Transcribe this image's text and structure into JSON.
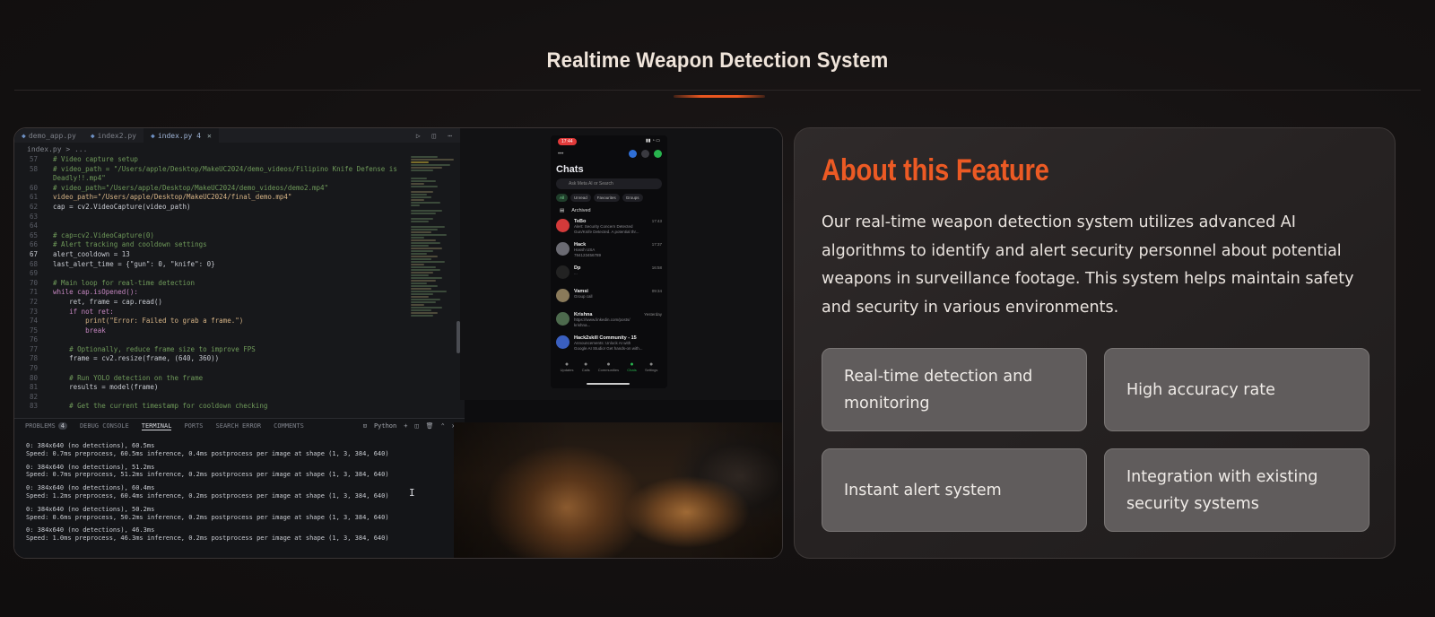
{
  "page": {
    "title": "Realtime Weapon Detection System"
  },
  "editor": {
    "tabs": [
      {
        "label": "demo_app.py",
        "active": false
      },
      {
        "label": "index2.py",
        "active": false
      },
      {
        "label": "index.py 4",
        "active": true
      }
    ],
    "breadcrumb": "index.py > ...",
    "code_lines": [
      {
        "n": "57",
        "text": "  # Video capture setup",
        "cls": "cmt"
      },
      {
        "n": "58",
        "text": "  # video_path = \"/Users/apple/Desktop/MakeUC2024/demo_videos/Filipino Knife Defense is",
        "cls": "cmt"
      },
      {
        "n": "",
        "text": "  Deadly!!.mp4\"",
        "cls": "cmt"
      },
      {
        "n": "60",
        "text": "  # video_path=\"/Users/apple/Desktop/MakeUC2024/demo_videos/demo2.mp4\"",
        "cls": "cmt"
      },
      {
        "n": "61",
        "text": "  video_path=\"/Users/apple/Desktop/MakeUC2024/final_demo.mp4\"",
        "cls": "str"
      },
      {
        "n": "62",
        "text": "  cap = cv2.VideoCapture(video_path)",
        "cls": ""
      },
      {
        "n": "63",
        "text": "",
        "cls": ""
      },
      {
        "n": "64",
        "text": "",
        "cls": ""
      },
      {
        "n": "65",
        "text": "  # cap=cv2.VideoCapture(0)",
        "cls": "cmt"
      },
      {
        "n": "66",
        "text": "  # Alert tracking and cooldown settings",
        "cls": "cmt"
      },
      {
        "n": "67",
        "text": "  alert_cooldown = 13",
        "cls": "",
        "cur": true
      },
      {
        "n": "68",
        "text": "  last_alert_time = {\"gun\": 0, \"knife\": 0}",
        "cls": ""
      },
      {
        "n": "69",
        "text": "",
        "cls": ""
      },
      {
        "n": "70",
        "text": "  # Main loop for real-time detection",
        "cls": "cmt"
      },
      {
        "n": "71",
        "text": "  while cap.isOpened():",
        "cls": "kw"
      },
      {
        "n": "72",
        "text": "      ret, frame = cap.read()",
        "cls": ""
      },
      {
        "n": "73",
        "text": "      if not ret:",
        "cls": "kw"
      },
      {
        "n": "74",
        "text": "          print(\"Error: Failed to grab a frame.\")",
        "cls": "str"
      },
      {
        "n": "75",
        "text": "          break",
        "cls": "kw"
      },
      {
        "n": "76",
        "text": "",
        "cls": ""
      },
      {
        "n": "77",
        "text": "      # Optionally, reduce frame size to improve FPS",
        "cls": "cmt"
      },
      {
        "n": "78",
        "text": "      frame = cv2.resize(frame, (640, 360))",
        "cls": ""
      },
      {
        "n": "79",
        "text": "",
        "cls": ""
      },
      {
        "n": "80",
        "text": "      # Run YOLO detection on the frame",
        "cls": "cmt"
      },
      {
        "n": "81",
        "text": "      results = model(frame)",
        "cls": ""
      },
      {
        "n": "82",
        "text": "",
        "cls": ""
      },
      {
        "n": "83",
        "text": "      # Get the current timestamp for cooldown checking",
        "cls": "cmt"
      }
    ],
    "panel_tabs": [
      {
        "label": "PROBLEMS",
        "badge": "4",
        "active": false
      },
      {
        "label": "DEBUG CONSOLE",
        "active": false
      },
      {
        "label": "TERMINAL",
        "active": true
      },
      {
        "label": "PORTS",
        "active": false
      },
      {
        "label": "SEARCH ERROR",
        "active": false
      },
      {
        "label": "COMMENTS",
        "active": false
      }
    ],
    "panel_tools_label": "Python",
    "terminal": [
      {
        "a": "0: 384x640 (no detections), 60.5ms",
        "b": "Speed: 0.7ms preprocess, 60.5ms inference, 0.4ms postprocess per image at shape (1, 3, 384, 640)"
      },
      {
        "a": "0: 384x640 (no detections), 51.2ms",
        "b": "Speed: 0.7ms preprocess, 51.2ms inference, 0.2ms postprocess per image at shape (1, 3, 384, 640)"
      },
      {
        "a": "0: 384x640 (no detections), 60.4ms",
        "b": "Speed: 1.2ms preprocess, 60.4ms inference, 0.2ms postprocess per image at shape (1, 3, 384, 640)"
      },
      {
        "a": "0: 384x640 (no detections), 50.2ms",
        "b": "Speed: 0.6ms preprocess, 50.2ms inference, 0.2ms postprocess per image at shape (1, 3, 384, 640)"
      },
      {
        "a": "0: 384x640 (no detections), 46.3ms",
        "b": "Speed: 1.0ms preprocess, 46.3ms inference, 0.2ms postprocess per image at shape (1, 3, 384, 640)"
      }
    ]
  },
  "phone": {
    "time": "17:44",
    "title": "Chats",
    "search_placeholder": "Ask Meta AI or Search",
    "filters": [
      "All",
      "Unread",
      "Favourites",
      "Groups"
    ],
    "archived": "Archived",
    "chats": [
      {
        "name": "TeBo",
        "preview": "Alert: Security Concern Detected",
        "preview2": "Gun/Knife Detected. A potential thr...",
        "time": "17:43",
        "color": "#d33a3a"
      },
      {
        "name": "Hack",
        "preview": "Hassh USA",
        "preview2": "784123456789",
        "time": "17:37",
        "color": "#6b6b73"
      },
      {
        "name": "Dp",
        "preview": "...",
        "preview2": "",
        "time": "16:58",
        "color": "#222"
      },
      {
        "name": "Vamsi",
        "preview": "Group call",
        "preview2": "",
        "time": "09:34",
        "color": "#8a7a5a"
      },
      {
        "name": "Krishna",
        "preview": "https://www.linkedin.com/posts/",
        "preview2": "krishna...",
        "time": "Yesterday",
        "color": "#4d6a4d"
      },
      {
        "name": "Hack2skill Community - 15",
        "preview": "Announcements: Unlock AI with",
        "preview2": "Google AI Studio! Get hands-on with...",
        "time": "",
        "color": "#3a5fbf"
      }
    ],
    "nav": [
      "Updates",
      "Calls",
      "Communities",
      "Chats",
      "Settings"
    ]
  },
  "about": {
    "title": "About this Feature",
    "description": "Our real-time weapon detection system utilizes advanced AI algorithms to identify and alert security personnel about potential weapons in surveillance footage. This system helps maintain safety and security in various environments.",
    "features": [
      "Real-time detection and monitoring",
      "High accuracy rate",
      "Instant alert system",
      "Integration with existing security systems"
    ]
  },
  "colors": {
    "accent": "#ec5a24",
    "background": "#141111",
    "card": "#2a2626",
    "feature_box": "#605c5c"
  }
}
